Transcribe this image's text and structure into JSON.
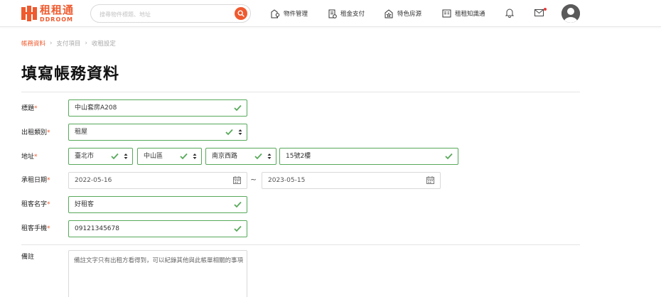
{
  "brand": {
    "name": "租租通",
    "sub": "DDROOM",
    "color": "#ef5a2e"
  },
  "search": {
    "placeholder": "搜尋物件標題、地址",
    "icon": "search-icon"
  },
  "nav": [
    {
      "label": "物件管理",
      "icon": "building-key-icon"
    },
    {
      "label": "租金支付",
      "icon": "document-pay-icon"
    },
    {
      "label": "特色房源",
      "icon": "house-star-icon"
    },
    {
      "label": "租租知識通",
      "icon": "knowledge-book-icon"
    }
  ],
  "breadcrumb": {
    "items": [
      "帳務資料",
      "支付項目",
      "收租設定"
    ]
  },
  "page": {
    "title": "填寫帳務資料"
  },
  "form": {
    "title": {
      "label": "標題",
      "value": "中山套房A208"
    },
    "rent_type": {
      "label": "出租類別",
      "value": "租屋"
    },
    "address": {
      "label": "地址",
      "city": "臺北市",
      "district": "中山區",
      "road": "南京西路",
      "detail": "15號2樓"
    },
    "period": {
      "label": "承租日期",
      "start": "2022-05-16",
      "separator": "~",
      "end": "2023-05-15"
    },
    "tenant_name": {
      "label": "租客名字",
      "value": "好租客"
    },
    "tenant_phone": {
      "label": "租客手機",
      "value": "09121345678"
    },
    "note": {
      "label": "備註",
      "placeholder": "備註文字只有出租方看得到，可以紀錄其他與此帳單相關的事項"
    },
    "required_mark": "*"
  },
  "colors": {
    "accent": "#ef5a2e",
    "valid": "#58a95b"
  }
}
